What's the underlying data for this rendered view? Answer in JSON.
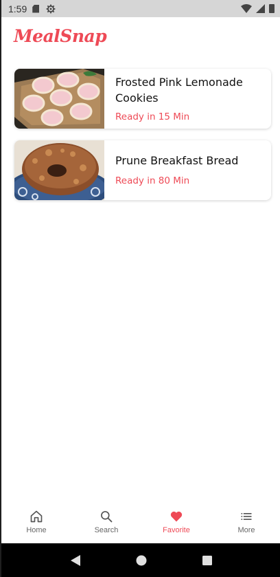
{
  "status_bar": {
    "time": "1:59",
    "icons": [
      "sd-card-icon",
      "gear-icon",
      "wifi-icon",
      "signal-icon",
      "battery-icon"
    ]
  },
  "app": {
    "logo_text": "MealSnap",
    "accent_color": "#ee4a56"
  },
  "favorites": [
    {
      "title": "Frosted Pink Lemonade Cookies",
      "ready_text": "Ready in 15 Min",
      "image_desc": "pink frosted cookies on a wooden board"
    },
    {
      "title": "Prune Breakfast Bread",
      "ready_text": "Ready in 80 Min",
      "image_desc": "bundt bread on a blue plate"
    }
  ],
  "bottom_nav": {
    "items": [
      {
        "label": "Home",
        "icon": "home-icon"
      },
      {
        "label": "Search",
        "icon": "search-icon"
      },
      {
        "label": "Favorite",
        "icon": "heart-icon",
        "active": true
      },
      {
        "label": "More",
        "icon": "menu-icon"
      }
    ]
  },
  "system_nav": {
    "buttons": [
      "back-icon",
      "home-circle-icon",
      "recents-icon"
    ]
  }
}
